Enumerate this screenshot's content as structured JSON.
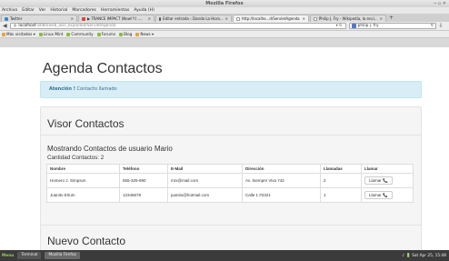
{
  "window": {
    "title": "Mozilla Firefox",
    "controls": "– ▫ ✕"
  },
  "menu": [
    "Archivo",
    "Editar",
    "Ver",
    "Historial",
    "Marcadores",
    "Herramientas",
    "Ayuda (H)"
  ],
  "tabs": [
    {
      "label": "Twitter",
      "color": "#3b88c3"
    },
    {
      "label": "▶ TRANCE IMPACT (Now!!!) ....",
      "color": "#e0453a"
    },
    {
      "label": "Editar entrada ‹ Dando La Hora...",
      "color": "#555555"
    },
    {
      "label": "http://localho...d/ServletAgenda",
      "color": "#ffffff",
      "active": true
    },
    {
      "label": "Philip J. Fry - Wikipedia, la enci...",
      "color": "#ffffff"
    }
  ],
  "nav": {
    "url_host": "localhost",
    "url_rest": ":8080/web_war_exploded/ServletAgenda",
    "search_value": "philip j. fry"
  },
  "bookmarks": [
    "Más visitados ▾",
    "Linux Mint",
    "Community",
    "Forums",
    "Blog",
    "News ▾"
  ],
  "page": {
    "title": "Agenda Contactos",
    "alert_strong": "Atención !",
    "alert_text": "Contacto llamado",
    "visor_title": "Visor Contactos",
    "mostrando": "Mostrando Contactos de usuario Mario",
    "cantidad": "Cantidad Contactos: 2",
    "nuevo_title": "Nuevo Contacto"
  },
  "table": {
    "headers": [
      "Nombre",
      "Teléfono",
      "E-Mail",
      "Dirección",
      "Llamadas",
      "Llamar"
    ],
    "rows": [
      {
        "nombre": "Homero J. Simpson",
        "telefono": "555-325-890",
        "email": "mrx@mail.com",
        "direccion": "Av. Siempre Viva 742",
        "llamadas": "2",
        "llamar": "Llamar 📞"
      },
      {
        "nombre": "Juanito Elrum",
        "telefono": "12345678",
        "email": "juanito@hotmail.com",
        "direccion": "Calle 1 #2321",
        "llamadas": "1",
        "llamar": "Llamar 📞"
      }
    ]
  },
  "taskbar": {
    "menu": "Menu",
    "tasks": [
      "Terminal",
      "Mozilla Firefox"
    ],
    "tray": "♪ 🔋 Sat Apr 25, 15:48"
  }
}
